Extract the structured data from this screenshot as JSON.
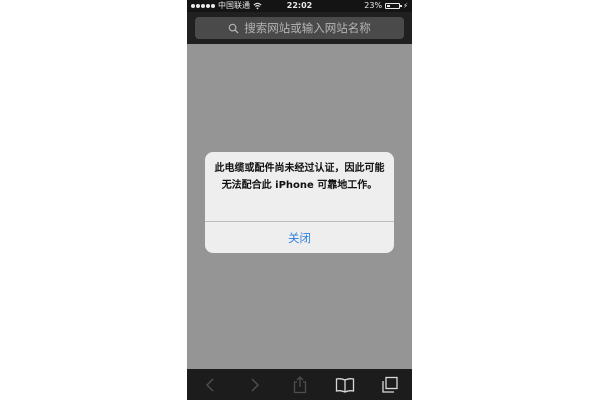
{
  "status_bar": {
    "carrier": "中国联通",
    "time": "22:02",
    "battery_text": "23%",
    "battery_level": 0.23
  },
  "address_bar": {
    "placeholder": "搜索网站或输入网站名称"
  },
  "alert": {
    "message": "此电缆或配件尚未经过认证，因此可能无法配合此 iPhone 可靠地工作。",
    "close_label": "关闭"
  },
  "toolbar": {
    "icons": [
      "back-icon",
      "forward-icon",
      "share-icon",
      "bookmarks-icon",
      "tabs-icon"
    ]
  },
  "colors": {
    "alert_button": "#2f7fe0",
    "background": "#959595",
    "bars": "#1c1c1c"
  }
}
